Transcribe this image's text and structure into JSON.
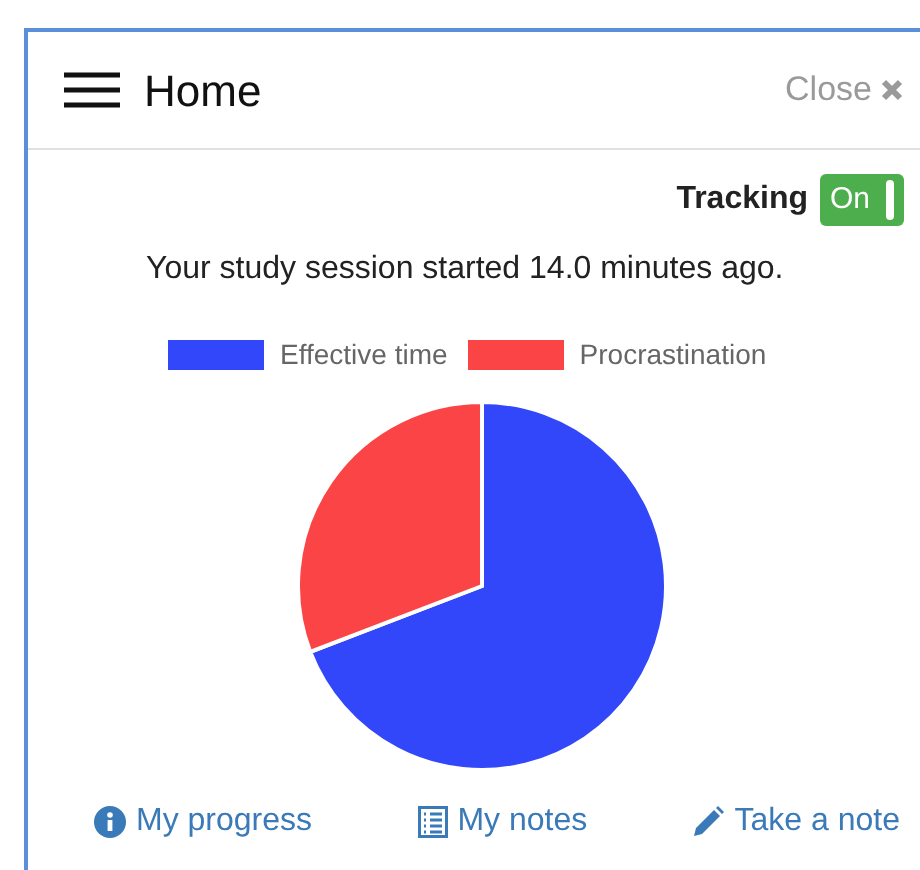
{
  "header": {
    "title": "Home",
    "close": "Close"
  },
  "tracking": {
    "label": "Tracking",
    "on": true,
    "state_text": "On"
  },
  "session_text": "Your study session started 14.0 minutes ago.",
  "legend": [
    {
      "label": "Effective time",
      "color": "#3347fa"
    },
    {
      "label": "Procrastination",
      "color": "#fa4445"
    }
  ],
  "links": [
    {
      "kind": "info",
      "label": "My progress"
    },
    {
      "kind": "list",
      "label": "My notes"
    },
    {
      "kind": "pencil",
      "label": "Take a note"
    }
  ]
}
